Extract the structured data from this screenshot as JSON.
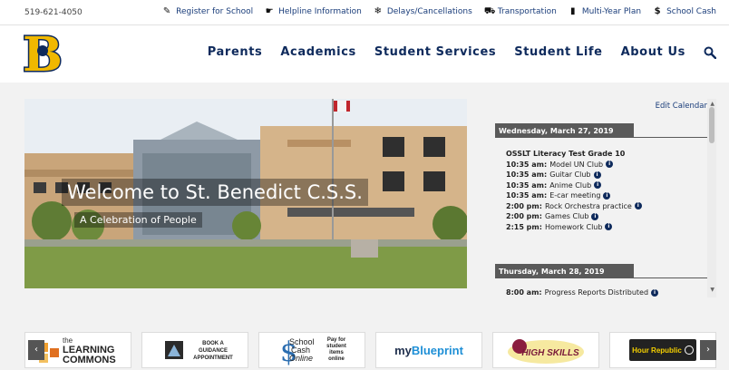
{
  "topbar": {
    "phone": "519-621-4050",
    "links": [
      {
        "label": "Register for School",
        "icon": "edit-icon",
        "glyph": "✎"
      },
      {
        "label": "Helpline Information",
        "icon": "hand-icon",
        "glyph": "☛"
      },
      {
        "label": "Delays/Cancellations",
        "icon": "snowflake-icon",
        "glyph": "❄"
      },
      {
        "label": "Transportation",
        "icon": "car-icon",
        "glyph": "⛟"
      },
      {
        "label": "Multi-Year Plan",
        "icon": "book-icon",
        "glyph": "▮"
      },
      {
        "label": "School Cash",
        "icon": "dollar-icon",
        "glyph": "$"
      }
    ]
  },
  "header": {
    "logo_letter": "B",
    "nav": [
      "Parents",
      "Academics",
      "Student Services",
      "Student Life",
      "About Us"
    ],
    "search_icon": "search-icon"
  },
  "hero": {
    "title": "Welcome to St. Benedict C.S.S.",
    "subtitle": "A Celebration of People"
  },
  "calendar": {
    "edit_label": "Edit Calendar",
    "days": [
      {
        "date": "Wednesday, March 27, 2019",
        "events": [
          {
            "time": "",
            "title": "OSSLT Literacy Test Grade 10",
            "bold_title": true,
            "info": false
          },
          {
            "time": "10:35 am:",
            "title": "Model UN Club",
            "info": true
          },
          {
            "time": "10:35 am:",
            "title": "Guitar Club",
            "info": true
          },
          {
            "time": "10:35 am:",
            "title": "Anime Club",
            "info": true
          },
          {
            "time": "10:35 am:",
            "title": "E-car meeting",
            "info": true
          },
          {
            "time": "2:00 pm:",
            "title": "Rock Orchestra practice",
            "info": true
          },
          {
            "time": "2:00 pm:",
            "title": "Games Club",
            "info": true
          },
          {
            "time": "2:15 pm:",
            "title": "Homework Club",
            "info": true
          }
        ]
      },
      {
        "date": "Thursday, March 28, 2019",
        "events": [
          {
            "time": "8:00 am:",
            "title": "Progress Reports Distributed",
            "info": true
          }
        ]
      }
    ]
  },
  "carousel": {
    "prev": "‹",
    "next": "›",
    "tiles": [
      {
        "name": "learning-commons-tile",
        "line1": "the",
        "line2": "LEARNING",
        "line3": "COMMONS"
      },
      {
        "name": "guidance-tile",
        "line1": "BOOK A",
        "line2": "GUIDANCE",
        "line3": "APPOINTMENT"
      },
      {
        "name": "school-cash-tile",
        "line1": "School",
        "line2": "Cash",
        "line3": "Online",
        "side1": "Pay for",
        "side2": "student",
        "side3": "items",
        "side4": "online"
      },
      {
        "name": "myblueprint-tile",
        "prefix": "my",
        "main": "Blueprint"
      },
      {
        "name": "high-skills-tile",
        "main": "HIGH SKILLS"
      },
      {
        "name": "hour-republic-tile",
        "main": "Hour Republic"
      }
    ]
  },
  "colors": {
    "navy": "#0e2a5c",
    "gold": "#f0b800",
    "link": "#1a3d7a"
  }
}
